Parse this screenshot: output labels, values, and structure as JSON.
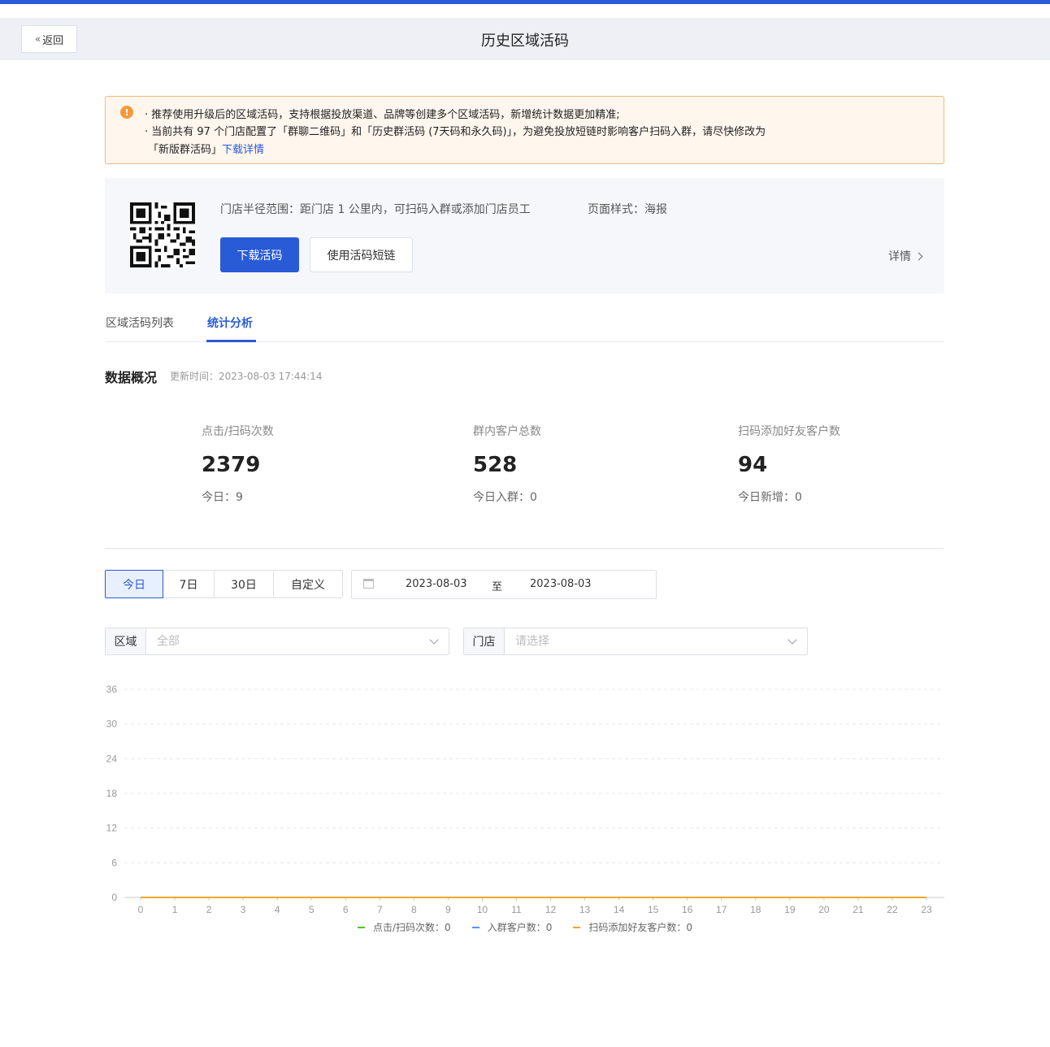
{
  "header": {
    "back_label": "返回",
    "title": "历史区域活码"
  },
  "alert": {
    "line1": "· 推荐使用升级后的区域活码，支持根据投放渠道、品牌等创建多个区域活码，新增统计数据更加精准;",
    "line2": "· 当前共有 97 个门店配置了「群聊二维码」和「历史群活码 (7天码和永久码)」，为避免投放短链时影响客户扫码入群，请尽快修改为",
    "line3_prefix": "「新版群活码」",
    "line3_link": "下载详情"
  },
  "code_card": {
    "radius_text": "门店半径范围：距门店 1 公里内，可扫码入群或添加门店员工",
    "style_text": "页面样式：海报",
    "download_label": "下载活码",
    "shortlink_label": "使用活码短链",
    "detail_label": "详情"
  },
  "tabs": [
    {
      "label": "区域活码列表"
    },
    {
      "label": "统计分析"
    }
  ],
  "overview": {
    "title": "数据概况",
    "update_time": "更新时间：2023-08-03 17:44:14"
  },
  "stats": [
    {
      "label": "点击/扫码次数",
      "value": "2379",
      "sub": "今日：9"
    },
    {
      "label": "群内客户总数",
      "value": "528",
      "sub": "今日入群：0"
    },
    {
      "label": "扫码添加好友客户数",
      "value": "94",
      "sub": "今日新增：0"
    }
  ],
  "range_buttons": [
    {
      "label": "今日"
    },
    {
      "label": "7日"
    },
    {
      "label": "30日"
    },
    {
      "label": "自定义"
    }
  ],
  "date_range": {
    "start": "2023-08-03",
    "separator": "至",
    "end": "2023-08-03"
  },
  "filters": {
    "region_label": "区域",
    "region_value": "全部",
    "store_label": "门店",
    "store_placeholder": "请选择"
  },
  "colors": {
    "accent": "#2a5bd7",
    "series_click": "#52c41a",
    "series_join": "#5b8ff9",
    "series_add": "#f5a623"
  },
  "chart_data": {
    "type": "line",
    "x": [
      0,
      1,
      2,
      3,
      4,
      5,
      6,
      7,
      8,
      9,
      10,
      11,
      12,
      13,
      14,
      15,
      16,
      17,
      18,
      19,
      20,
      21,
      22,
      23
    ],
    "ylim": [
      0,
      36
    ],
    "yticks": [
      0,
      6,
      12,
      18,
      24,
      30,
      36
    ],
    "grid": true,
    "legend_position": "bottom",
    "series": [
      {
        "name": "点击/扫码次数",
        "legend_text": "点击/扫码次数：0",
        "color": "#52c41a",
        "values": [
          0,
          0,
          0,
          0,
          0,
          0,
          0,
          0,
          0,
          0,
          0,
          0,
          0,
          0,
          0,
          0,
          0,
          0,
          0,
          0,
          0,
          0,
          0,
          0
        ]
      },
      {
        "name": "入群客户数",
        "legend_text": "入群客户数：0",
        "color": "#5b8ff9",
        "values": [
          0,
          0,
          0,
          0,
          0,
          0,
          0,
          0,
          0,
          0,
          0,
          0,
          0,
          0,
          0,
          0,
          0,
          0,
          0,
          0,
          0,
          0,
          0,
          0
        ]
      },
      {
        "name": "扫码添加好友客户数",
        "legend_text": "扫码添加好友客户数：0",
        "color": "#f5a623",
        "values": [
          0,
          0,
          0,
          0,
          0,
          0,
          0,
          0,
          0,
          0,
          0,
          0,
          0,
          0,
          0,
          0,
          0,
          0,
          0,
          0,
          0,
          0,
          0,
          0
        ]
      }
    ]
  }
}
